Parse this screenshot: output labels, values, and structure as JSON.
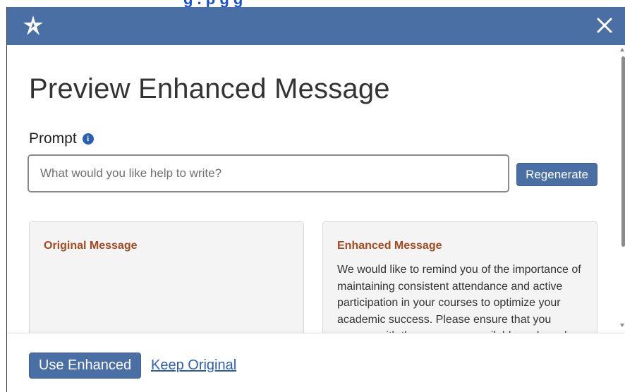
{
  "background": {
    "partial_text": "g .   p   g g"
  },
  "header": {
    "logo_icon": "star-logo-icon",
    "close_icon": "close-icon",
    "color": "#4a6fa5"
  },
  "main": {
    "title": "Preview Enhanced Message",
    "prompt": {
      "label": "Prompt",
      "info_icon": "info-icon",
      "placeholder": "What would you like help to write?",
      "value": "",
      "regenerate_label": "Regenerate"
    },
    "original": {
      "title": "Original Message",
      "text": ""
    },
    "enhanced": {
      "title": "Enhanced Message",
      "text": "We would like to remind you of the importance of maintaining consistent attendance and active participation in your courses to optimize your academic success. Please ensure that you engage with the resources available and reach"
    }
  },
  "footer": {
    "use_enhanced_label": "Use Enhanced",
    "keep_original_label": "Keep Original"
  },
  "colors": {
    "accent": "#4a6fa5",
    "card_title": "#a54a1f",
    "link": "#2b5fb4"
  }
}
